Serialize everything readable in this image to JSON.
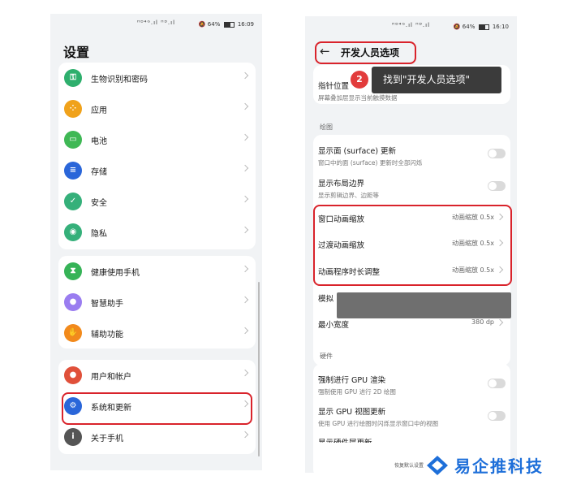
{
  "left_phone": {
    "status": {
      "signal": "ᴴᴰ⁴ᴳ.ıl ᴴᴰ.ıl",
      "right_text": "64%",
      "time": "16:09"
    },
    "title": "设置",
    "groups": [
      {
        "items": [
          {
            "label": "生物识别和密码",
            "icon": "key-icon",
            "color": "#2eaf6d",
            "glyph": "⚿"
          },
          {
            "label": "应用",
            "icon": "apps-icon",
            "color": "#f0a21b",
            "glyph": "⁘"
          },
          {
            "label": "电池",
            "icon": "battery-icon",
            "color": "#3fb855",
            "glyph": "▭"
          },
          {
            "label": "存储",
            "icon": "storage-icon",
            "color": "#2a66d9",
            "glyph": "≡"
          },
          {
            "label": "安全",
            "icon": "shield-icon",
            "color": "#35b07a",
            "glyph": "✓"
          },
          {
            "label": "隐私",
            "icon": "privacy-icon",
            "color": "#35b07a",
            "glyph": "◉"
          }
        ]
      },
      {
        "items": [
          {
            "label": "健康使用手机",
            "icon": "hourglass-icon",
            "color": "#36b357",
            "glyph": "⧗"
          },
          {
            "label": "智慧助手",
            "icon": "assistant-icon",
            "color": "#9a7df0",
            "glyph": "●"
          },
          {
            "label": "辅助功能",
            "icon": "hand-icon",
            "color": "#f28a1c",
            "glyph": "✋"
          }
        ]
      },
      {
        "items": [
          {
            "label": "用户和帐户",
            "icon": "user-icon",
            "color": "#e0503a",
            "glyph": "●"
          },
          {
            "label": "系统和更新",
            "icon": "gear-icon",
            "color": "#2a66d9",
            "glyph": "⚙"
          },
          {
            "label": "关于手机",
            "icon": "info-icon",
            "color": "#555555",
            "glyph": "i"
          }
        ]
      }
    ]
  },
  "right_phone": {
    "status": {
      "signal": "ᴴᴰ⁴ᴳ.ıl ᴴᴰ.ıl",
      "right_text": "64%",
      "time": "16:10"
    },
    "header_title": "开发人员选项",
    "tooltip": {
      "step": "2",
      "text": "找到\"开发人员选项\""
    },
    "pointer": {
      "title": "指针位置",
      "subtitle": "屏幕叠加层显示当前触摸数据"
    },
    "section_drawing": "绘图",
    "surface": {
      "title": "显示面 (surface) 更新",
      "subtitle": "窗口中的面 (surface) 更新时全部闪烁"
    },
    "layout_bounds": {
      "title": "显示布局边界",
      "subtitle": "显示剪辑边界、边距等"
    },
    "animations": [
      {
        "title": "窗口动画缩放",
        "value": "动画缩放 0.5x"
      },
      {
        "title": "过渡动画缩放",
        "value": "动画缩放 0.5x"
      },
      {
        "title": "动画程序时长调整",
        "value": "动画缩放 0.5x"
      }
    ],
    "simulate": {
      "title": "模拟"
    },
    "min_width": {
      "title": "最小宽度",
      "value": "380 dp"
    },
    "section_hardware": "硬件",
    "gpu_render": {
      "title": "强制进行 GPU 渲染",
      "subtitle": "强制使用 GPU 进行 2D 绘图"
    },
    "gpu_view": {
      "title": "显示 GPU 视图更新",
      "subtitle": "使用 GPU 进行绘图时闪烁显示窗口中的视图"
    },
    "bottom_cut": "显示硬件层更新",
    "bottom_small": "恢复默认设置"
  },
  "watermark": {
    "text": "易企推科技"
  }
}
